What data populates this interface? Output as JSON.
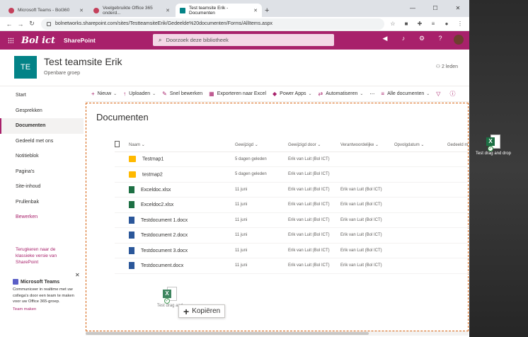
{
  "browser": {
    "tabs": [
      {
        "title": "Microsoft Teams - Bol360",
        "active": false
      },
      {
        "title": "Veelgebruikte Office 365 onderd...",
        "active": false
      },
      {
        "title": "Test teamsite Erik - Documenten",
        "active": true
      }
    ],
    "url": "bolnetworks.sharepoint.com/sites/TestteamsiteErik/Gedeelde%20documenten/Forms/AllItems.aspx"
  },
  "suitebar": {
    "logo": "Bol ict",
    "app_name": "SharePoint",
    "search_placeholder": "Doorzoek deze bibliotheek",
    "color": "#a8216b"
  },
  "site": {
    "logo_initials": "TE",
    "title": "Test teamsite Erik",
    "subtitle": "Openbare groep",
    "members": "2 leden"
  },
  "nav": {
    "items": [
      {
        "label": "Start"
      },
      {
        "label": "Gesprekken"
      },
      {
        "label": "Documenten",
        "active": true
      },
      {
        "label": "Gedeeld met ons"
      },
      {
        "label": "Notitieblok"
      },
      {
        "label": "Pagina's"
      },
      {
        "label": "Site-inhoud"
      },
      {
        "label": "Prullenbak"
      },
      {
        "label": "Bewerken"
      }
    ],
    "back_link": "Terugkeren naar de klassieke versie van SharePoint"
  },
  "teams_card": {
    "title": "Microsoft Teams",
    "body": "Communiceer in realtime met uw collega's door een team te maken voor uw Office 365-groep.",
    "link": "Team maken"
  },
  "commands": {
    "new": "Nieuw",
    "upload": "Uploaden",
    "quick_edit": "Snel bewerken",
    "export": "Exporteren naar Excel",
    "power_apps": "Power Apps",
    "automate": "Automatiseren",
    "more": "⋯",
    "view": "Alle documenten"
  },
  "library": {
    "title": "Documenten",
    "columns": [
      "Naam",
      "Gewijzigd",
      "Gewijzigd door",
      "Verantwoordelijke",
      "Opvolgdatum",
      "Gedeeld m"
    ],
    "rows": [
      {
        "type": "folder",
        "name": "Testmap1",
        "modified": "5 dagen geleden",
        "modified_by": "Erik van Luit (Bol ICT)",
        "owner": "",
        "followup": "",
        "shared": ""
      },
      {
        "type": "folder",
        "name": "testmap2",
        "modified": "5 dagen geleden",
        "modified_by": "Erik van Luit (Bol ICT)",
        "owner": "",
        "followup": "",
        "shared": ""
      },
      {
        "type": "xlsx",
        "name": "Exceldoc.xlsx",
        "modified": "11 juni",
        "modified_by": "Erik van Luit (Bol ICT)",
        "owner": "Erik van Luit (Bol ICT)",
        "followup": "",
        "shared": ""
      },
      {
        "type": "xlsx",
        "name": "Exceldoc2.xlsx",
        "modified": "11 juni",
        "modified_by": "Erik van Luit (Bol ICT)",
        "owner": "Erik van Luit (Bol ICT)",
        "followup": "",
        "shared": ""
      },
      {
        "type": "docx",
        "name": "Testdocument 1.docx",
        "modified": "11 juni",
        "modified_by": "Erik van Luit (Bol ICT)",
        "owner": "Erik van Luit (Bol ICT)",
        "followup": "",
        "shared": ""
      },
      {
        "type": "docx",
        "name": "Testdocument 2.docx",
        "modified": "11 juni",
        "modified_by": "Erik van Luit (Bol ICT)",
        "owner": "Erik van Luit (Bol ICT)",
        "followup": "",
        "shared": ""
      },
      {
        "type": "docx",
        "name": "Testdocument 3.docx",
        "modified": "11 juni",
        "modified_by": "Erik van Luit (Bol ICT)",
        "owner": "Erik van Luit (Bol ICT)",
        "followup": "",
        "shared": ""
      },
      {
        "type": "docx",
        "name": "Testdocument.docx",
        "modified": "11 juni",
        "modified_by": "Erik van Luit (Bol ICT)",
        "owner": "Erik van Luit (Bol ICT)",
        "followup": "",
        "shared": ""
      }
    ]
  },
  "drag": {
    "ghost_label": "Test drag and",
    "copy_label": "Kopiëren"
  },
  "desktop": {
    "file_label": "Test drag and drop"
  }
}
